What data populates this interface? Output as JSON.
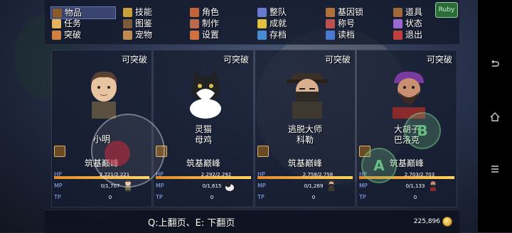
{
  "menu": [
    {
      "label": "物品",
      "icon": "bag-icon",
      "color": "#8b5a2b",
      "selected": true
    },
    {
      "label": "技能",
      "icon": "skill-icon",
      "color": "#c9a03a",
      "selected": false
    },
    {
      "label": "角色",
      "icon": "character-icon",
      "color": "#c2663a",
      "selected": false
    },
    {
      "label": "整队",
      "icon": "team-icon",
      "color": "#6a7acc",
      "selected": false
    },
    {
      "label": "基因锁",
      "icon": "gene-lock-icon",
      "color": "#b0703a",
      "selected": false
    },
    {
      "label": "道具",
      "icon": "tool-icon",
      "color": "#a0683a",
      "selected": false
    },
    {
      "label": "任务",
      "icon": "quest-icon",
      "color": "#e6b45a",
      "selected": false
    },
    {
      "label": "图鉴",
      "icon": "book-icon",
      "color": "#7a5a3a",
      "selected": false
    },
    {
      "label": "制作",
      "icon": "craft-icon",
      "color": "#b86a4a",
      "selected": false
    },
    {
      "label": "成就",
      "icon": "achievement-icon",
      "color": "#e0c040",
      "selected": false
    },
    {
      "label": "称号",
      "icon": "title-icon",
      "color": "#c05050",
      "selected": false
    },
    {
      "label": "状态",
      "icon": "status-icon",
      "color": "#9a6ad0",
      "selected": false
    },
    {
      "label": "突破",
      "icon": "breakthrough-icon",
      "color": "#d08040",
      "selected": false
    },
    {
      "label": "宠物",
      "icon": "pet-icon",
      "color": "#c08a50",
      "selected": false
    },
    {
      "label": "设置",
      "icon": "settings-icon",
      "color": "#d07040",
      "selected": false
    },
    {
      "label": "存档",
      "icon": "save-icon",
      "color": "#4a8ad0",
      "selected": false
    },
    {
      "label": "读档",
      "icon": "load-icon",
      "color": "#4a7ad0",
      "selected": false
    },
    {
      "label": "退出",
      "icon": "exit-icon",
      "color": "#c04040",
      "selected": false
    }
  ],
  "corner_badge": "Ruby",
  "characters": [
    {
      "breakable": "可突破",
      "name": "小明",
      "subname": "",
      "realm": "筑基巅峰",
      "hp": "2,221/2,221",
      "mp": "0/1,707",
      "tp": "0",
      "hp_ratio": 1.0,
      "portrait": "boy-portrait",
      "sprite": "boy-sprite"
    },
    {
      "breakable": "可突破",
      "name": "灵猫",
      "subname": "母鸡",
      "realm": "筑基巅峰",
      "hp": "2,292/2,292",
      "mp": "0/1,615",
      "tp": "0",
      "hp_ratio": 1.0,
      "portrait": "cat-portrait",
      "sprite": "cat-sprite"
    },
    {
      "breakable": "可突破",
      "name": "逃脱大师",
      "subname": "科勒",
      "realm": "筑基巅峰",
      "hp": "2,758/2,758",
      "mp": "0/1,269",
      "tp": "0",
      "hp_ratio": 1.0,
      "portrait": "masked-man-portrait",
      "sprite": "masked-man-sprite"
    },
    {
      "breakable": "可突破",
      "name": "大胡子",
      "subname": "巴洛克",
      "realm": "筑基巅峰",
      "hp": "2,703/2,703",
      "mp": "0/1,133",
      "tp": "0",
      "hp_ratio": 1.0,
      "portrait": "bearded-man-portrait",
      "sprite": "bearded-man-sprite"
    }
  ],
  "stat_labels": {
    "hp": "HP",
    "mp": "MP",
    "tp": "TP"
  },
  "hint": "Q:上翻页、E: 下翻页",
  "gold": "225,896",
  "buttons": {
    "a": "A",
    "b": "B"
  }
}
